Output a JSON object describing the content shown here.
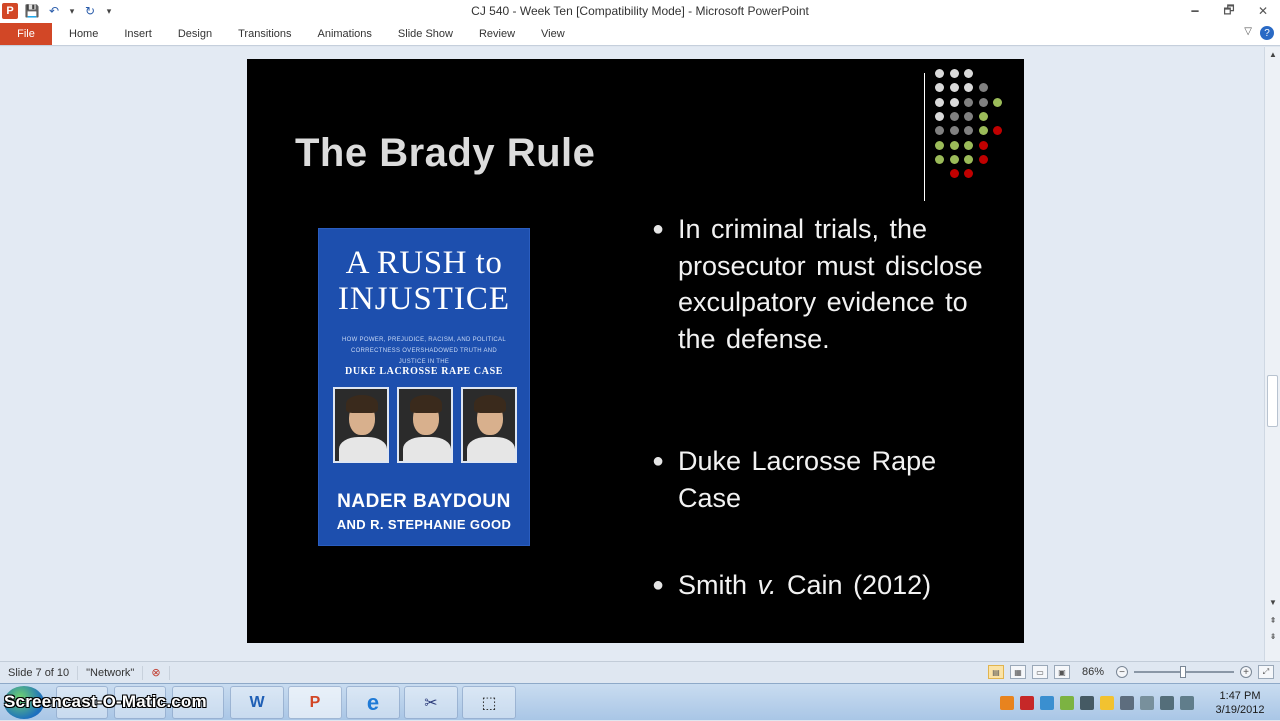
{
  "window": {
    "title": "CJ 540 - Week Ten [Compatibility Mode] - Microsoft PowerPoint",
    "minimize": "🗕",
    "restore": "🗗",
    "close": "✕"
  },
  "qat": {
    "app_icon": "P",
    "save_icon": "💾",
    "undo_icon": "↶",
    "undo_dropdown": "▾",
    "redo_icon": "↻",
    "customize": "▾"
  },
  "ribbon": {
    "tabs": [
      {
        "label": "File"
      },
      {
        "label": "Home"
      },
      {
        "label": "Insert"
      },
      {
        "label": "Design"
      },
      {
        "label": "Transitions"
      },
      {
        "label": "Animations"
      },
      {
        "label": "Slide Show"
      },
      {
        "label": "Review"
      },
      {
        "label": "View"
      }
    ],
    "collapse_icon": "▽",
    "help_icon": "?"
  },
  "slide": {
    "title": "The Brady Rule",
    "book": {
      "title_line1": "A RUSH to",
      "title_line2": "INJUSTICE",
      "subtitle": "HOW POWER, PREJUDICE, RACISM, AND POLITICAL CORRECTNESS OVERSHADOWED TRUTH AND JUSTICE IN THE",
      "case": "DUKE LACROSSE RAPE CASE",
      "author1": "NADER BAYDOUN",
      "author2": "AND R. STEPHANIE GOOD"
    },
    "bullets": [
      {
        "mark": "●",
        "text": "In criminal trials, the prosecutor must disclose exculpatory evidence to the defense."
      },
      {
        "mark": "●",
        "text": "Duke Lacrosse Rape Case"
      },
      {
        "mark": "●",
        "text": "Smith v. Cain (2012)"
      }
    ],
    "bullet3_parts": {
      "before": "Smith ",
      "italic": "v.",
      "after": " Cain (2012)"
    },
    "colors": {
      "background": "#000000",
      "title": "#dcdcdc",
      "text": "#f2f2f2",
      "dot_light": "#d9d9d9",
      "dot_gray": "#808080",
      "dot_green": "#9bbb59",
      "dot_red": "#c00000"
    }
  },
  "statusbar": {
    "slide_indicator": "Slide 7 of 10",
    "theme": "\"Network\"",
    "spellcheck_icon": "⊗",
    "zoom": "86%",
    "zoom_out": "−",
    "zoom_in": "+",
    "fit_icon": "⤢"
  },
  "taskbar": {
    "watermark": "Screencast-O-Matic.com",
    "apps": [
      {
        "name": "word",
        "glyph": "W"
      },
      {
        "name": "powerpoint",
        "glyph": "P"
      },
      {
        "name": "internet-explorer",
        "glyph": "e"
      },
      {
        "name": "snipping",
        "glyph": "✂"
      },
      {
        "name": "capture",
        "glyph": "⬚"
      }
    ],
    "clock_time": "1:47 PM",
    "clock_date": "3/19/2012"
  }
}
